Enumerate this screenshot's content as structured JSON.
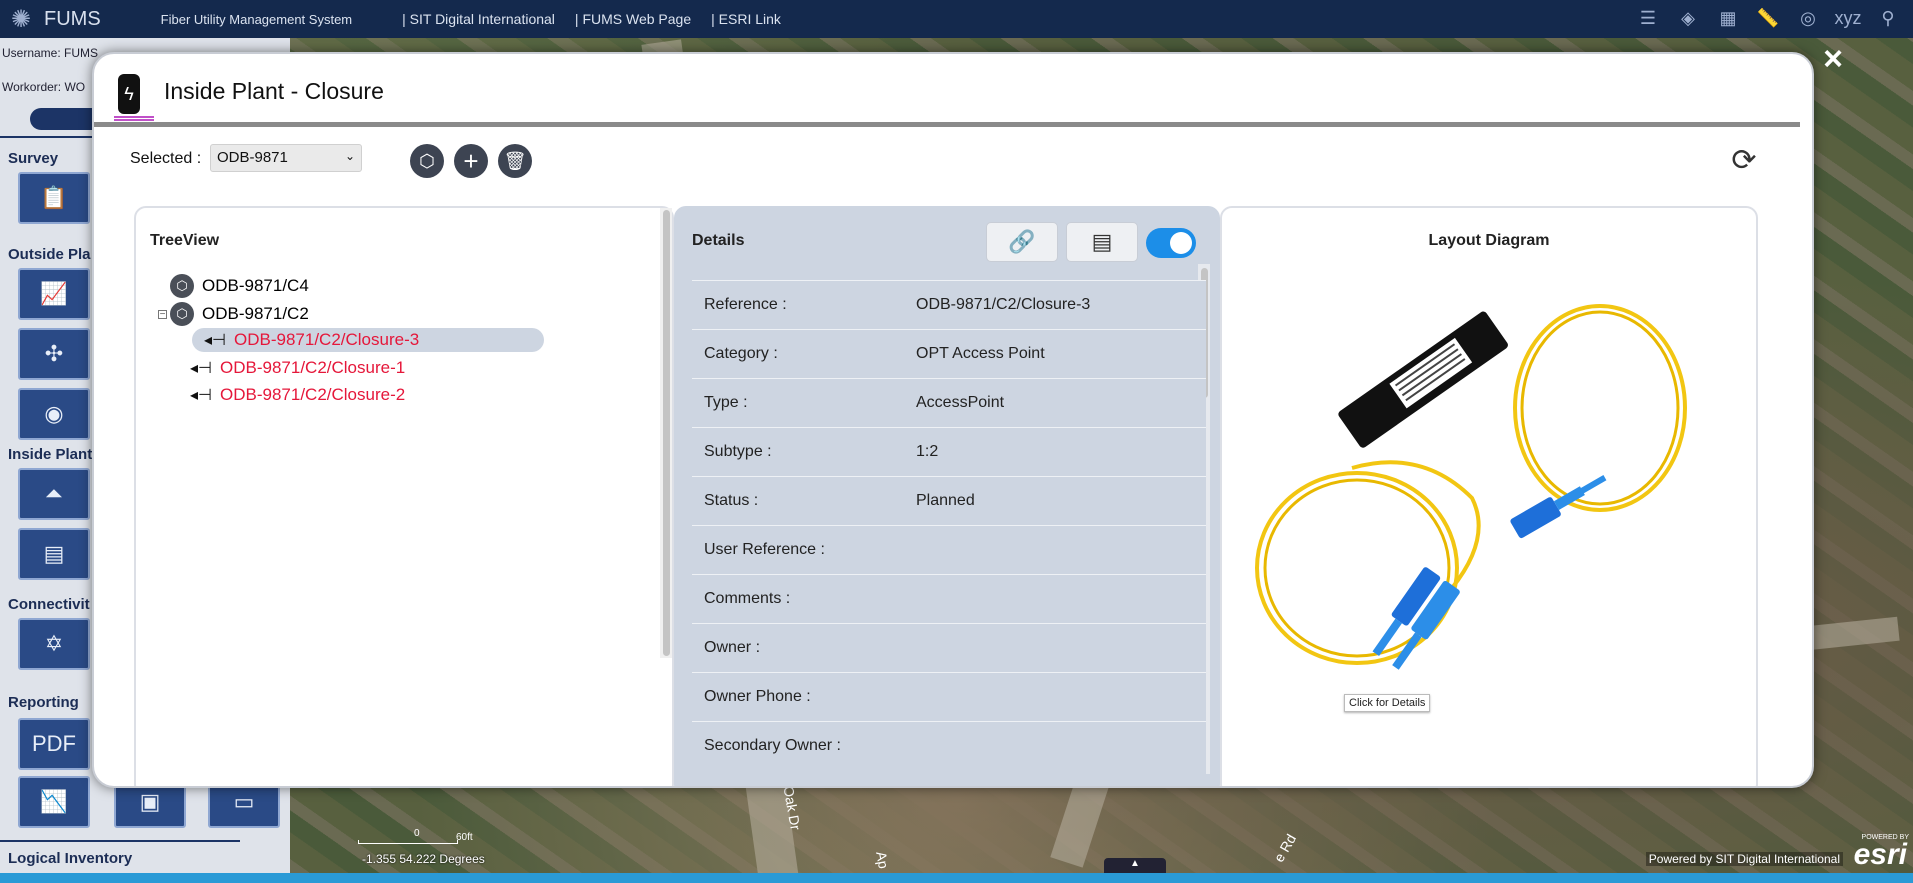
{
  "topbar": {
    "app_name": "FUMS",
    "subtitle": "Fiber Utility Management System",
    "links": [
      "| SIT Digital International",
      "| FUMS Web Page",
      "| ESRI Link"
    ]
  },
  "left_panel": {
    "username": "Username: FUMS",
    "workorder": "Workorder: WO",
    "sections": [
      "Survey",
      "Outside Pla",
      "Inside Plant",
      "Connectivit",
      "Reporting",
      "Logical Inventory"
    ]
  },
  "map": {
    "scale_label": "60ft",
    "scale_zero": "0",
    "coords": "-1.355 54.222 Degrees",
    "powered_by": "Powered by SIT Digital International",
    "esri_small": "POWERED BY",
    "esri": "esri",
    "streets": [
      "Oak Dr",
      "Ap",
      "e Rd"
    ]
  },
  "modal": {
    "title": "Inside Plant - Closure",
    "close": "×",
    "selected_label": "Selected :",
    "selected_value": "ODB-9871",
    "tree": {
      "title": "TreeView",
      "nodes": [
        {
          "label": "ODB-9871/C4"
        },
        {
          "label": "ODB-9871/C2"
        },
        {
          "label": "ODB-9871/C2/Closure-3"
        },
        {
          "label": "ODB-9871/C2/Closure-1"
        },
        {
          "label": "ODB-9871/C2/Closure-2"
        }
      ]
    },
    "details": {
      "title": "Details",
      "rows": [
        {
          "label": "Reference :",
          "value": "ODB-9871/C2/Closure-3"
        },
        {
          "label": "Category :",
          "value": "OPT Access Point"
        },
        {
          "label": "Type :",
          "value": "AccessPoint"
        },
        {
          "label": "Subtype :",
          "value": "1:2"
        },
        {
          "label": "Status :",
          "value": "Planned"
        },
        {
          "label": "User Reference :",
          "value": ""
        },
        {
          "label": "Comments :",
          "value": ""
        },
        {
          "label": "Owner :",
          "value": ""
        },
        {
          "label": "Owner Phone :",
          "value": ""
        },
        {
          "label": "Secondary Owner :",
          "value": ""
        }
      ]
    },
    "layout": {
      "title": "Layout Diagram",
      "tooltip": "Click for Details"
    }
  },
  "colors": {
    "topbar": "#14294d",
    "accent": "#1c8ee8",
    "selected_node": "#e5173a"
  }
}
